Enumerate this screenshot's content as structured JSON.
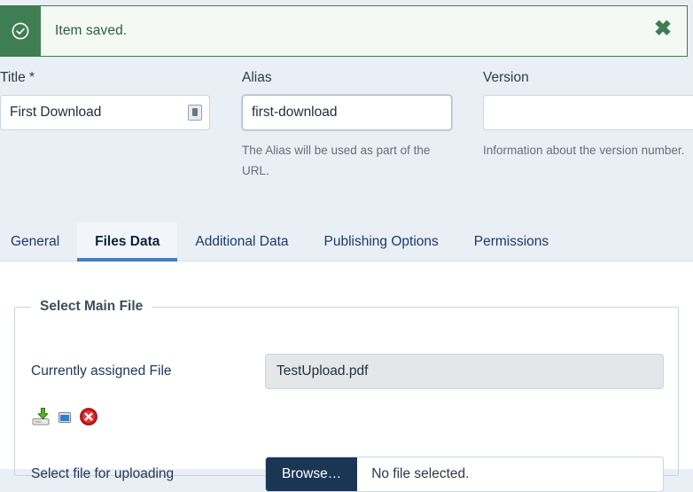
{
  "alert": {
    "icon": "check-circle-icon",
    "message": "Item saved.",
    "close_label": "✖",
    "bg": "#f4f9f4",
    "accent": "#3f7d52"
  },
  "form": {
    "title_field": {
      "label": "Title *",
      "value": "First Download",
      "placeholder": "",
      "inline_icon": "password-manager-icon"
    },
    "alias_field": {
      "label": "Alias",
      "value": "first-download",
      "placeholder": "",
      "help": "The Alias will be used as part of the URL."
    },
    "version_field": {
      "label": "Version",
      "value": "",
      "placeholder": "",
      "help": "Information about the version number."
    }
  },
  "tabs": {
    "active_index": 1,
    "items": [
      {
        "label": "General"
      },
      {
        "label": "Files Data"
      },
      {
        "label": "Additional Data"
      },
      {
        "label": "Publishing Options"
      },
      {
        "label": "Permissions"
      }
    ],
    "active_underline_color": "#4a7ebb"
  },
  "panel": {
    "fieldset_legend": "Select Main File",
    "assigned": {
      "label": "Currently assigned File",
      "value": "TestUpload.pdf"
    },
    "actions": [
      {
        "name": "download-file-icon",
        "title": "Download"
      },
      {
        "name": "preview-window-icon",
        "title": "Preview"
      },
      {
        "name": "delete-file-icon",
        "title": "Delete"
      }
    ],
    "upload": {
      "label": "Select file for uploading",
      "browse_label": "Browse…",
      "status": "No file selected."
    }
  }
}
